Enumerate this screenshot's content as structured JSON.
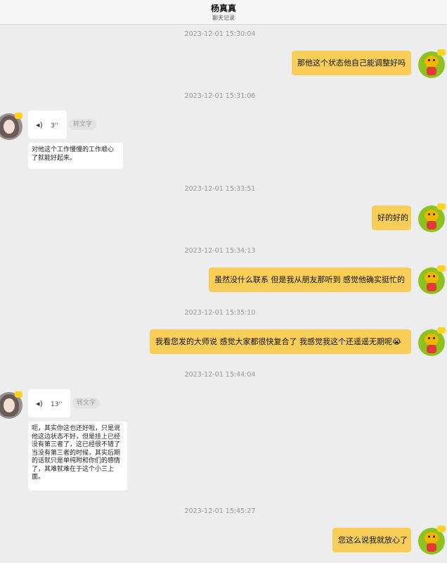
{
  "header": {
    "back_icon": "chevron-left-icon",
    "title": "杨真真",
    "subtitle": "聊天记录"
  },
  "timestamps": [
    "2023-12-01 15:30:04",
    "2023-12-01 15:31:06",
    "2023-12-01 15:33:51",
    "2023-12-01 15:34:13",
    "2023-12-01 15:35:10",
    "2023-12-01 15:44:04",
    "2023-12-01 15:45:27"
  ],
  "right_messages": [
    "那他这个状态他自己能调整好吗",
    "好的好的",
    "虽然没什么联系 但是我从朋友那听到 感觉他确实挺忙的",
    "我看您发的大师说 感觉大家都很快复合了 我感觉我这个还遥遥无期呢😭",
    "您这么说我就放心了"
  ],
  "voice_messages": [
    {
      "duration": "3''",
      "to_text": "转文字",
      "transcript": "对他这个工作慢慢的工作顺心了就能好起来。"
    },
    {
      "duration": "13''",
      "to_text": "转文字",
      "transcript": "呃，其实你这也还好啦，只是说他这边状态不好，但是挂上已经没有第三者了，这已经很不错了当没有第三者的时候，其实后期的话就只是单纯附和你们的感情了，其难就难在于这个小三上面。"
    }
  ],
  "icons": {
    "voice": "voice-wave-icon",
    "self_avatar": "tiger-avatar",
    "contact_avatar": "contact-avatar"
  },
  "colors": {
    "bubble_self": "#f8ce58",
    "bubble_other": "#ffffff",
    "background": "#ededed"
  }
}
